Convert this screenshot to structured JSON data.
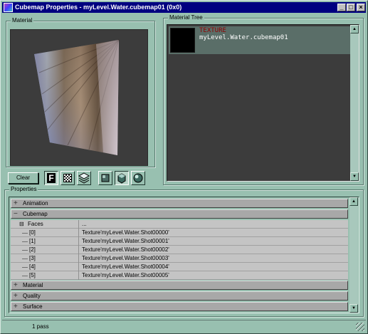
{
  "window": {
    "title": "Cubemap Properties - myLevel.Water.cubemap01 (0x0)",
    "buttons": {
      "minimize": "_",
      "maximize": "□",
      "close": "×"
    }
  },
  "material_group": {
    "label": "Material"
  },
  "material_tree": {
    "label": "Material Tree",
    "item": {
      "type": "TEXTURE",
      "name": "myLevel.Water.cubemap01"
    }
  },
  "toolbar": {
    "clear_label": "Clear",
    "tools": [
      {
        "icon": "font-f-icon",
        "glyph": "F",
        "pressed": true
      },
      {
        "icon": "checker-background-icon"
      },
      {
        "icon": "layers-icon"
      },
      {
        "icon": "plane-preview-icon"
      },
      {
        "icon": "cube-preview-icon",
        "pressed": true
      },
      {
        "icon": "sphere-preview-icon"
      }
    ]
  },
  "properties": {
    "label": "Properties",
    "categories": [
      {
        "label": "Animation",
        "expanded": false
      },
      {
        "label": "Cubemap",
        "expanded": true
      },
      {
        "label": "Material",
        "expanded": false
      },
      {
        "label": "Quality",
        "expanded": false
      },
      {
        "label": "Surface",
        "expanded": false
      }
    ],
    "faces": {
      "label": "Faces",
      "value": "...",
      "items": [
        {
          "index": "[0]",
          "value": "Texture'myLevel.Water.Shot00000'"
        },
        {
          "index": "[1]",
          "value": "Texture'myLevel.Water.Shot00001'"
        },
        {
          "index": "[2]",
          "value": "Texture'myLevel.Water.Shot00002'"
        },
        {
          "index": "[3]",
          "value": "Texture'myLevel.Water.Shot00003'"
        },
        {
          "index": "[4]",
          "value": "Texture'myLevel.Water.Shot00004'"
        },
        {
          "index": "[5]",
          "value": "Texture'myLevel.Water.Shot00005'"
        }
      ]
    }
  },
  "status": {
    "text": "1 pass"
  },
  "colors": {
    "window_bg": "#98c0b0",
    "title_bg": "#000080",
    "viewport_bg": "#3c3c3c",
    "tree_type_text": "#900000",
    "property_row_bg": "#c4c4c4",
    "category_bg": "#a8a8a8"
  }
}
